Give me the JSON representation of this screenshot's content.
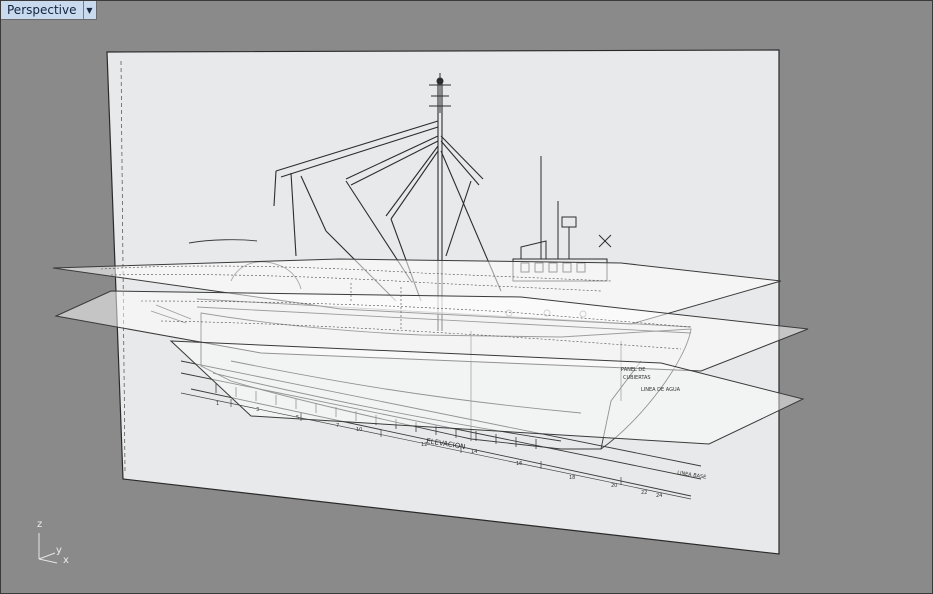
{
  "viewport": {
    "title": "Perspective",
    "menu_icon": "triangle-down-icon",
    "background_color": "#8a8a8a",
    "tab_color": "#c9d9ee"
  },
  "drawing_text": {
    "elevation_title": "ELEVACION",
    "base_line": "LINEA BASE",
    "deck_label_1": "PANEL DE",
    "deck_label_2": "CUBIERTAS",
    "deck_label_3": "LINEA DE AGUA",
    "station_numbers": [
      "0",
      "1",
      "2",
      "3",
      "4",
      "5",
      "6",
      "7",
      "8",
      "9",
      "10",
      "11",
      "12",
      "13",
      "14",
      "15",
      "16",
      "17",
      "18",
      "19",
      "20",
      "21",
      "22",
      "23",
      "24"
    ]
  },
  "axis_widget": {
    "z": "z",
    "y": "y",
    "x": "x"
  }
}
